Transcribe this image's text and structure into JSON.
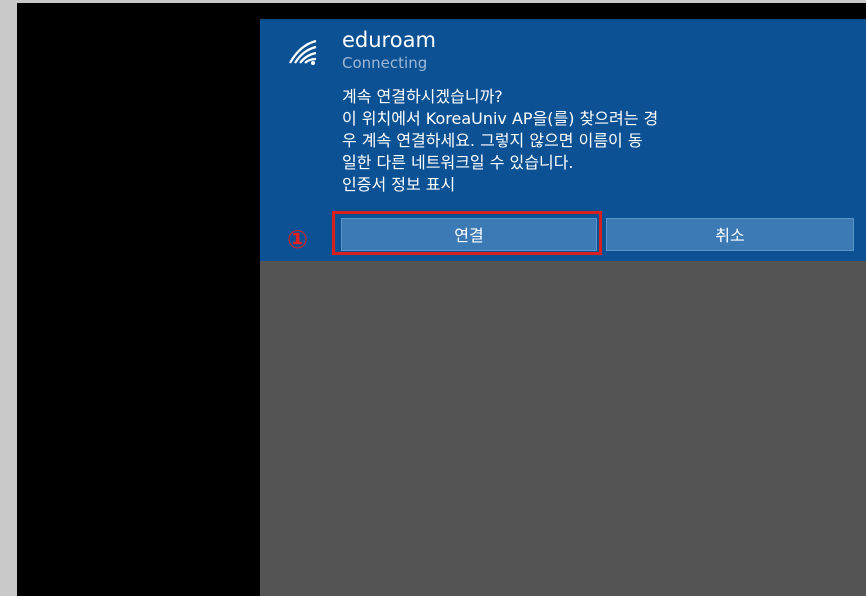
{
  "network": {
    "name": "eduroam",
    "status": "Connecting",
    "icon": "wifi-icon"
  },
  "dialog": {
    "message_lines": [
      "계속 연결하시겠습니까?",
      "이 위치에서 KoreaUniv AP을(를) 찾으려는 경",
      "우 계속 연결하세요. 그렇지 않으면 이름이 동",
      "일한 다른 네트워크일 수 있습니다.",
      "인증서 정보 표시"
    ]
  },
  "buttons": {
    "connect_label": "연결",
    "cancel_label": "취소"
  },
  "annotation": {
    "step_marker": "①"
  },
  "colors": {
    "flyout_bg": "#0b5193",
    "button_bg": "#3b7ab5",
    "highlight": "#d9201f"
  }
}
